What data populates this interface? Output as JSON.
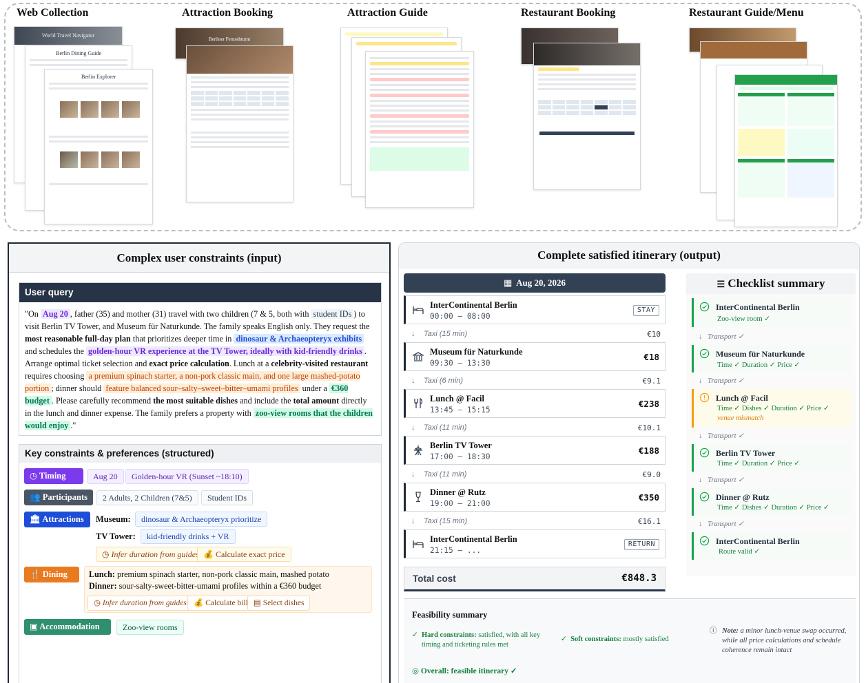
{
  "web_collection": {
    "titles": [
      "Web Collection",
      "Attraction Booking",
      "Attraction Guide",
      "Restaurant Booking",
      "Restaurant Guide/Menu"
    ],
    "page_headings": [
      "World Travel Navigator",
      "Berlin Dining Guide",
      "Berlin Explorer",
      "Berliner Fernsehturm"
    ]
  },
  "left": {
    "title": "Complex user constraints (input)",
    "user_query_header": "User query",
    "query": {
      "p1": "\"On ",
      "date": "Aug 20",
      "p2": ", father (35) and mother (31) travel with two children (7 & 5, both with ",
      "student_ids": "student IDs",
      "p3": ") to visit Berlin TV Tower, and Museum für Naturkunde. The family speaks English only. They request the ",
      "b1": "most reasonable full-day plan",
      "p4": " that prioritizes deeper time in ",
      "dino": "dinosaur & Archaeopteryx exhibits",
      "p5": " and schedules the ",
      "vr": "golden-hour VR experience at the TV Tower, ideally with kid-friendly drinks",
      "p6": ". Arrange optimal ticket selection and ",
      "b2": "exact price calculation",
      "p7": ". Lunch at a ",
      "b3": "celebrity-visited restaurant",
      "p8": " requires choosing ",
      "lunch": "a premium spinach starter, a non-pork classic main, and one large mashed-potato portion",
      "p9": "; dinner should ",
      "dinner": "feature balanced sour–salty–sweet–bitter–umami profiles",
      "p10": " under a ",
      "budget": "€360 budget",
      "p11": ". Please carefully recommend ",
      "b4": "the most suitable dishes",
      "p12": " and include the ",
      "b5": "total amount",
      "p13": " directly in the lunch and dinner expense. The family prefers a property with ",
      "zoo": "zoo-view rooms that the children would enjoy",
      "p14": ".\""
    },
    "constraints_header": "Key constraints & preferences (structured)",
    "timing": {
      "label": "Timing",
      "chips": [
        "Aug 20",
        "Golden-hour VR (Sunset ~18:10)"
      ]
    },
    "participants": {
      "label": "Participants",
      "chips": [
        "2 Adults, 2 Children (7&5)",
        "Student IDs"
      ]
    },
    "attractions": {
      "label": "Attractions",
      "museum_label": "Museum:",
      "museum_chip": "dinosaur & Archaeopteryx prioritize",
      "tower_label": "TV Tower:",
      "tower_chip": "kid-friendly drinks + VR",
      "infer": "Infer duration from guides",
      "calc": "Calculate exact price"
    },
    "dining": {
      "label": "Dining",
      "lunch_label": "Lunch:",
      "lunch_text": " premium spinach starter, non-pork classic main, mashed potato",
      "dinner_label": "Dinner:",
      "dinner_text": " sour-salty-sweet-bitter-umami profiles within a €360 budget",
      "infer": "Infer duration from guides",
      "bill": "Calculate bill",
      "dishes": "Select dishes"
    },
    "accommodation": {
      "label": "Accommodation",
      "chip": "Zoo-view rooms"
    }
  },
  "right": {
    "title": "Complete satisfied itinerary (output)",
    "day": "Aug 20, 2026",
    "stops": [
      {
        "name": "InterContinental Berlin",
        "time": "00:00 – 08:00",
        "tag": "STAY",
        "icon": "bed-icon"
      },
      {
        "name": "Museum für Naturkunde",
        "time": "09:30 – 13:30",
        "price": "€18",
        "icon": "museum-icon"
      },
      {
        "name": "Lunch @ Facil",
        "time": "13:45 – 15:15",
        "price": "€238",
        "icon": "utensils-icon"
      },
      {
        "name": "Berlin TV Tower",
        "time": "17:00 – 18:30",
        "price": "€188",
        "icon": "tower-icon"
      },
      {
        "name": "Dinner @ Rutz",
        "time": "19:00 – 21:00",
        "price": "€350",
        "icon": "wine-icon"
      },
      {
        "name": "InterContinental Berlin",
        "time": "21:15 – ...",
        "tag": "RETURN",
        "icon": "bed-icon"
      }
    ],
    "taxis": [
      {
        "label": "Taxi (15 min)",
        "cost": "€10"
      },
      {
        "label": "Taxi (6 min)",
        "cost": "€9.1"
      },
      {
        "label": "Taxi (11 min)",
        "cost": "€10.1"
      },
      {
        "label": "Taxi (11 min)",
        "cost": "€9.0"
      },
      {
        "label": "Taxi (15 min)",
        "cost": "€16.1"
      }
    ],
    "total_label": "Total cost",
    "total_value": "€848.3",
    "checklist": {
      "title": "Checklist summary",
      "transport": "Transport ✓",
      "items": [
        {
          "name": "InterContinental Berlin",
          "status": "Zoo-view room ✓"
        },
        {
          "name": "Museum für Naturkunde",
          "status": "Time ✓  Duration ✓  Price ✓"
        },
        {
          "name": "Lunch @ Facil",
          "status": "Time ✓  Dishes ✓  Duration ✓  Price ✓",
          "note": "venue mismatch"
        },
        {
          "name": "Berlin TV Tower",
          "status": "Time ✓  Duration ✓  Price ✓"
        },
        {
          "name": "Dinner @ Rutz",
          "status": "Time ✓  Dishes ✓  Duration ✓  Price ✓"
        },
        {
          "name": "InterContinental Berlin",
          "status": "Route valid ✓"
        }
      ]
    },
    "feasibility": {
      "title": "Feasibility summary",
      "hard_label": "Hard constraints:",
      "hard_text": " satisfied, with all key timing and ticketing rules met",
      "soft_label": "Soft constraints:",
      "soft_text": " mostly satisfied",
      "note_label": "Note:",
      "note_text": " a minor lunch-venue swap occurred, while all price calculations and schedule coherence remain intact",
      "overall": "Overall: feasible itinerary ✓"
    }
  }
}
